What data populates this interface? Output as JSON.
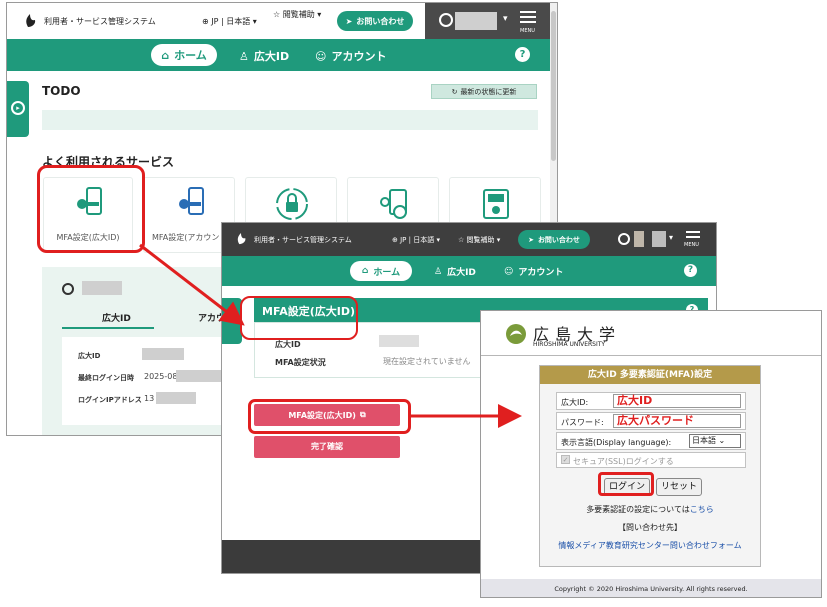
{
  "app": {
    "system_title": "利用者・サービス管理システム",
    "language": "JP | 日本語",
    "accessibility": "閲覧補助",
    "contact": "お問い合わせ",
    "menu": "MENU"
  },
  "nav": {
    "home": "ホーム",
    "hirodai_id": "広大ID",
    "account": "アカウント",
    "help": "?"
  },
  "win1": {
    "todo_title": "TODO",
    "refresh": "最新の状態に更新",
    "services_title": "よく利用されるサービス",
    "services": [
      {
        "label": "MFA設定(広大ID)"
      },
      {
        "label": "MFA設定(アカウント"
      }
    ],
    "tabs": [
      "広大ID",
      "アカウ"
    ],
    "info": [
      {
        "label": "広大ID",
        "value": ""
      },
      {
        "label": "最終ログイン日時",
        "value": "2025-08-"
      },
      {
        "label": "ログインIPアドレス",
        "value": "13"
      }
    ]
  },
  "win2": {
    "panel_title": "MFA設定(広大ID)",
    "fields": [
      {
        "label": "広大ID",
        "value": ""
      },
      {
        "label": "MFA設定状況",
        "value": "現在設定されていません"
      }
    ],
    "mfa_button": "MFA設定(広大ID)",
    "done_button": "完了確認"
  },
  "win3": {
    "university_jp": "広島大学",
    "university_en": "HIROSHIMA UNIVERSITY",
    "form_title": "広大ID 多要素認証(MFA)設定",
    "id_label": "広大ID:",
    "id_value": "広大ID",
    "pw_label": "パスワード:",
    "pw_value": "広大パスワード",
    "lang_label": "表示言語(Display language):",
    "lang_value": "日本語",
    "ssl_label": "セキュア(SSL)ログインする",
    "login_button": "ログイン",
    "reset_button": "リセット",
    "mfa_note": "多要素認証の設定については",
    "mfa_link": "こちら",
    "contact_title": "【問い合わせ先】",
    "contact_link": "情報メディア教育研究センター問い合わせフォーム",
    "copyright": "Copyright © 2020 Hiroshima University. All rights reserved."
  },
  "colors": {
    "brand": "#1f9a7c",
    "alert": "#e01f1f",
    "button_pink": "#e0506a",
    "form_gold": "#b49a4a"
  }
}
